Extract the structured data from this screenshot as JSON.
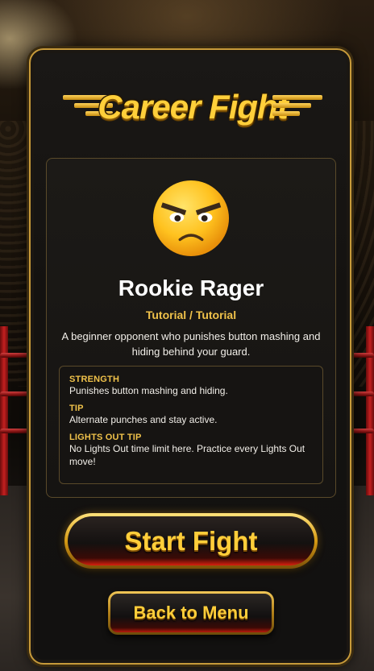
{
  "logo": {
    "text": "Career Fight"
  },
  "opponent": {
    "name": "Rookie Rager",
    "mode": "Tutorial / Tutorial",
    "description": "A beginner opponent who punishes button mashing and hiding behind your guard.",
    "portrait_icon": "angry-face-emoji"
  },
  "details": {
    "strength_label": "STRENGTH",
    "strength": "Punishes button mashing and hiding.",
    "tip_label": "TIP",
    "tip": "Alternate punches and stay active.",
    "lights_out_label": "LIGHTS OUT TIP",
    "lights_out": "No Lights Out time limit here. Practice every Lights Out move!"
  },
  "buttons": {
    "start": "Start Fight",
    "back": "Back to Menu"
  },
  "colors": {
    "gold": "#f0c24a",
    "panel_border": "#c79a3a",
    "rope_red": "#c42020"
  }
}
